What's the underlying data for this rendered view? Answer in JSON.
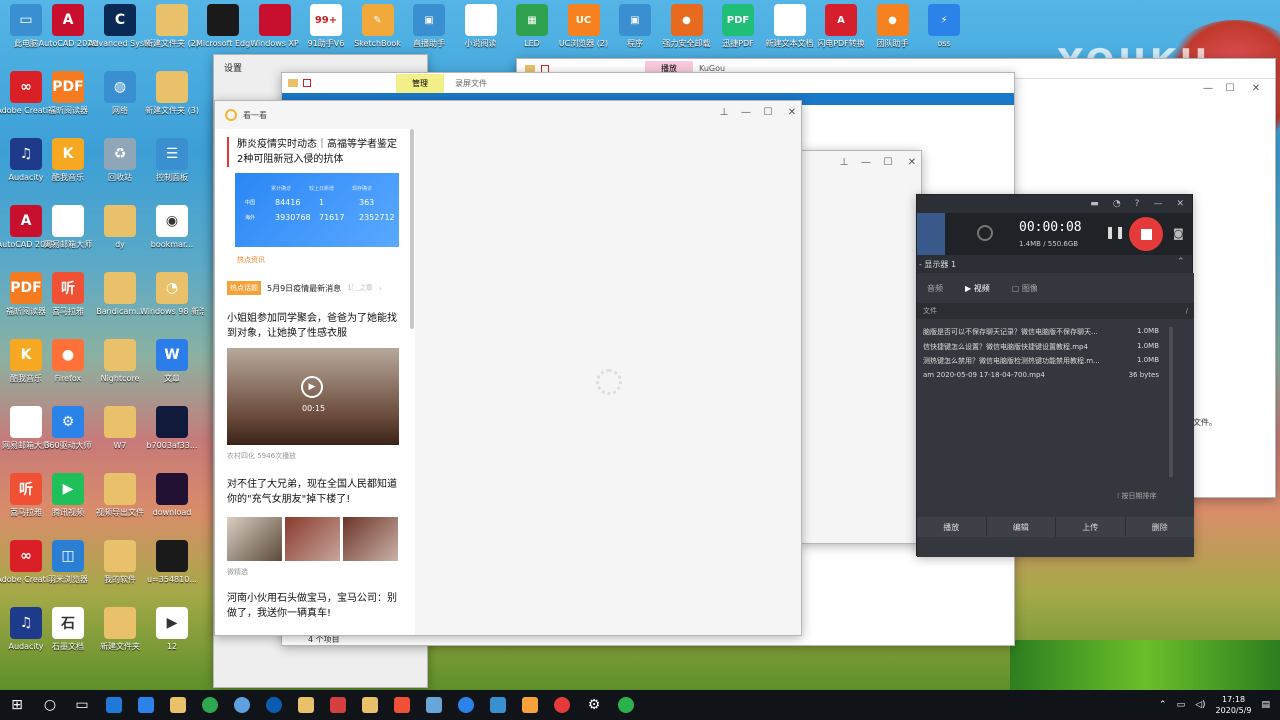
{
  "watermark": "YOUKU",
  "desktop_col1": [
    {
      "label": "此电脑",
      "color": "#3a8fd0",
      "glyph": "▭",
      "icon": "computer-icon"
    },
    {
      "label": "Adobe Creati...",
      "color": "#da1f26",
      "glyph": "∞",
      "icon": "adobe-creative-icon"
    },
    {
      "label": "Audacity",
      "color": "#1e3a8a",
      "glyph": "♫",
      "icon": "audacity-icon"
    },
    {
      "label": "AutoCAD 2019",
      "color": "#c8102e",
      "glyph": "A",
      "icon": "autocad-icon"
    },
    {
      "label": "福昕阅读器",
      "color": "#f47b20",
      "glyph": "PDF",
      "icon": "foxit-reader-icon"
    },
    {
      "label": "酷我音乐",
      "color": "#f7a823",
      "glyph": "K",
      "icon": "kuwo-music-icon"
    },
    {
      "label": "网易邮箱大师",
      "color": "#ffffff",
      "glyph": "",
      "icon": "netease-mail-icon"
    },
    {
      "label": "喜马拉雅",
      "color": "#f05134",
      "glyph": "听",
      "icon": "ximalaya-icon"
    },
    {
      "label": "Adobe Creati...",
      "color": "#da1f26",
      "glyph": "∞",
      "icon": "adobe-creative-icon"
    },
    {
      "label": "Audacity",
      "color": "#1e3a8a",
      "glyph": "♫",
      "icon": "audacity-icon"
    }
  ],
  "desktop_col2": [
    {
      "label": "AutoCAD 2019",
      "color": "#c8102e",
      "glyph": "A",
      "icon": "autocad-icon"
    },
    {
      "label": "福昕阅读器",
      "color": "#f47b20",
      "glyph": "PDF",
      "icon": "foxit-reader-icon"
    },
    {
      "label": "酷我音乐",
      "color": "#f7a823",
      "glyph": "K",
      "icon": "kuwo-music-icon"
    },
    {
      "label": "网易邮箱大师",
      "color": "#ffffff",
      "glyph": "",
      "icon": "netease-mail-icon"
    },
    {
      "label": "喜马拉雅",
      "color": "#f05134",
      "glyph": "听",
      "icon": "ximalaya-icon"
    },
    {
      "label": "Firefox",
      "color": "#ff7139",
      "glyph": "●",
      "icon": "firefox-icon"
    },
    {
      "label": "360驱动大师",
      "color": "#2b82e8",
      "glyph": "⚙",
      "icon": "driver-master-icon"
    },
    {
      "label": "腾讯视频",
      "color": "#1fbf5a",
      "glyph": "▶",
      "icon": "tencent-video-icon"
    },
    {
      "label": "羽米浏览器",
      "color": "#2a7fd4",
      "glyph": "◫",
      "icon": "browser-icon"
    },
    {
      "label": "石墨文档",
      "color": "#ffffff",
      "glyph": "石",
      "icon": "shimo-docs-icon"
    }
  ],
  "desktop_col3": [
    {
      "label": "Advanced SystemCare",
      "color": "#0a2a55",
      "glyph": "C",
      "icon": "systemcare-icon"
    },
    {
      "label": "网络",
      "color": "#3a8fd0",
      "glyph": "◍",
      "icon": "network-icon"
    },
    {
      "label": "回收站",
      "color": "#8fa5b8",
      "glyph": "♻",
      "icon": "recycle-bin-icon"
    },
    {
      "label": "dy",
      "color": "#e8c16a",
      "glyph": "",
      "icon": "folder-icon"
    },
    {
      "label": "Bandicam...",
      "color": "#e8c16a",
      "glyph": "",
      "icon": "folder-icon"
    },
    {
      "label": "Nightcore",
      "color": "#e8c16a",
      "glyph": "",
      "icon": "folder-icon"
    },
    {
      "label": "W7",
      "color": "#e8c16a",
      "glyph": "",
      "icon": "folder-icon"
    },
    {
      "label": "视频导出文件",
      "color": "#e8c16a",
      "glyph": "",
      "icon": "folder-icon"
    },
    {
      "label": "我的软件",
      "color": "#e8c16a",
      "glyph": "",
      "icon": "folder-icon"
    },
    {
      "label": "新建文件夹",
      "color": "#e8c16a",
      "glyph": "",
      "icon": "folder-icon"
    }
  ],
  "desktop_col4": [
    {
      "label": "新建文件夹 (2)",
      "color": "#e8c16a",
      "glyph": "",
      "icon": "folder-icon"
    },
    {
      "label": "新建文件夹 (3)",
      "color": "#e8c16a",
      "glyph": "",
      "icon": "folder-icon"
    },
    {
      "label": "控制面板",
      "color": "#3a8fd0",
      "glyph": "☰",
      "icon": "control-panel-icon"
    },
    {
      "label": "bookmar...",
      "color": "#ffffff",
      "glyph": "◉",
      "icon": "bookmark-file-icon"
    },
    {
      "label": "Windows 98 新浩战壳",
      "color": "#e8c16a",
      "glyph": "◔",
      "icon": "windows98-icon"
    },
    {
      "label": "文章",
      "color": "#2b7de9",
      "glyph": "W",
      "icon": "word-icon"
    },
    {
      "label": "b7003af33...",
      "color": "#111a3a",
      "glyph": "",
      "icon": "image-file-icon"
    },
    {
      "label": "download",
      "color": "#221133",
      "glyph": "",
      "icon": "image-file-icon"
    },
    {
      "label": "u=354810...",
      "color": "#1a1a1a",
      "glyph": "",
      "icon": "image-file-icon"
    },
    {
      "label": "12",
      "color": "#ffffff",
      "glyph": "▶",
      "icon": "video-file-icon"
    }
  ],
  "desktop_top": [
    {
      "label": "Microsoft Edge",
      "color": "#1a1a1a",
      "glyph": "",
      "icon": "app-icon"
    },
    {
      "label": "Windows XP",
      "color": "#c8102e",
      "glyph": "",
      "icon": "app-icon"
    },
    {
      "label": "91助手V6",
      "color": "#ffffff",
      "glyph": "99+",
      "icon": "assistant-icon"
    },
    {
      "label": "SketchBook",
      "color": "#f2a93b",
      "glyph": "✎",
      "icon": "sketchbook-icon"
    },
    {
      "label": "直播助手",
      "color": "#3a8fd0",
      "glyph": "▣",
      "icon": "app-icon"
    },
    {
      "label": "小说阅读",
      "color": "#ffffff",
      "glyph": "",
      "icon": "document-icon"
    },
    {
      "label": "LED",
      "color": "#30a14e",
      "glyph": "▦",
      "icon": "app-icon"
    },
    {
      "label": "UC浏览器 (2)",
      "color": "#f5821f",
      "glyph": "UC",
      "icon": "uc-browser-icon"
    },
    {
      "label": "程序",
      "color": "#3a8fd0",
      "glyph": "▣",
      "icon": "app-icon"
    },
    {
      "label": "强力安全卸载",
      "color": "#e86a1f",
      "glyph": "●",
      "icon": "uninstall-icon"
    },
    {
      "label": "迅捷PDF",
      "color": "#1fbf7a",
      "glyph": "PDF",
      "icon": "pdf-icon"
    },
    {
      "label": "新建文本文档",
      "color": "#ffffff",
      "glyph": "",
      "icon": "document-icon"
    },
    {
      "label": "闪电PDF转换",
      "color": "#d61f2c",
      "glyph": "A",
      "icon": "pdf-converter-icon"
    },
    {
      "label": "团队助手",
      "color": "#f5821f",
      "glyph": "●",
      "icon": "app-icon"
    },
    {
      "label": "oss",
      "color": "#2b82e8",
      "glyph": "⚡",
      "icon": "app-icon"
    }
  ],
  "settings": {
    "title": "设置"
  },
  "explorer": {
    "tab_manage": "管理",
    "path_title": "录屏文件",
    "status": "4 个项目"
  },
  "explorer2": {
    "tab_play": "播放",
    "title": "KuGou",
    "side_text": "文件。"
  },
  "news": {
    "window_title": "看一看",
    "headline": "肺炎疫情实时动态｜高福等学者鉴定2种可阻新冠入侵的抗体",
    "stats_labels": [
      "累计确诊",
      "较上日新增",
      "现存确诊"
    ],
    "stats_rows": [
      [
        "中国",
        "84416",
        "1",
        "363"
      ],
      [
        "海外",
        "3930768",
        "71617",
        "2352712"
      ]
    ],
    "hot_tag": "热点资讯",
    "topic_badge": "热点话题",
    "topic_text": "5月9日疫情最新消息",
    "topic_more": "1篇文章",
    "story2": "小姐姐参加同学聚会，爸爸为了她能找到对象，让她换了性感衣服",
    "video_duration": "00:15",
    "story2_meta": "农村四化  5946次播放",
    "story3": "对不住了大兄弟，现在全国人民都知道你的\"充气女朋友\"掉下楼了!",
    "story3_meta": "微精选",
    "story4": "河南小伙用石头做宝马，宝马公司：别做了，我送你一辆真车!"
  },
  "recorder": {
    "timer": "00:00:08",
    "size": "1.4MB / 550.6GB",
    "display": "- 显示器 1",
    "tab_video": "视频",
    "tab_image": "图像",
    "tab_audio": "音频",
    "list_header": "文件",
    "files": [
      {
        "name": "脑版是否可以不保存聊天记录？微信电脑版不保存聊天...",
        "size": "1.0MB"
      },
      {
        "name": "信快捷键怎么设置？微信电脑版快捷键设置教程.mp4",
        "size": "1.0MB"
      },
      {
        "name": "测热键怎么禁用？微信电脑版检测热键功能禁用教程.m...",
        "size": "1.0MB"
      },
      {
        "name": "am 2020-05-09 17-18-04-700.mp4",
        "size": "36 bytes"
      }
    ],
    "sort": "按日期排序",
    "actions": [
      "播放",
      "编辑",
      "上传",
      "删除"
    ]
  },
  "taskbar": {
    "time": "17:18",
    "date": "2020/5/9"
  }
}
